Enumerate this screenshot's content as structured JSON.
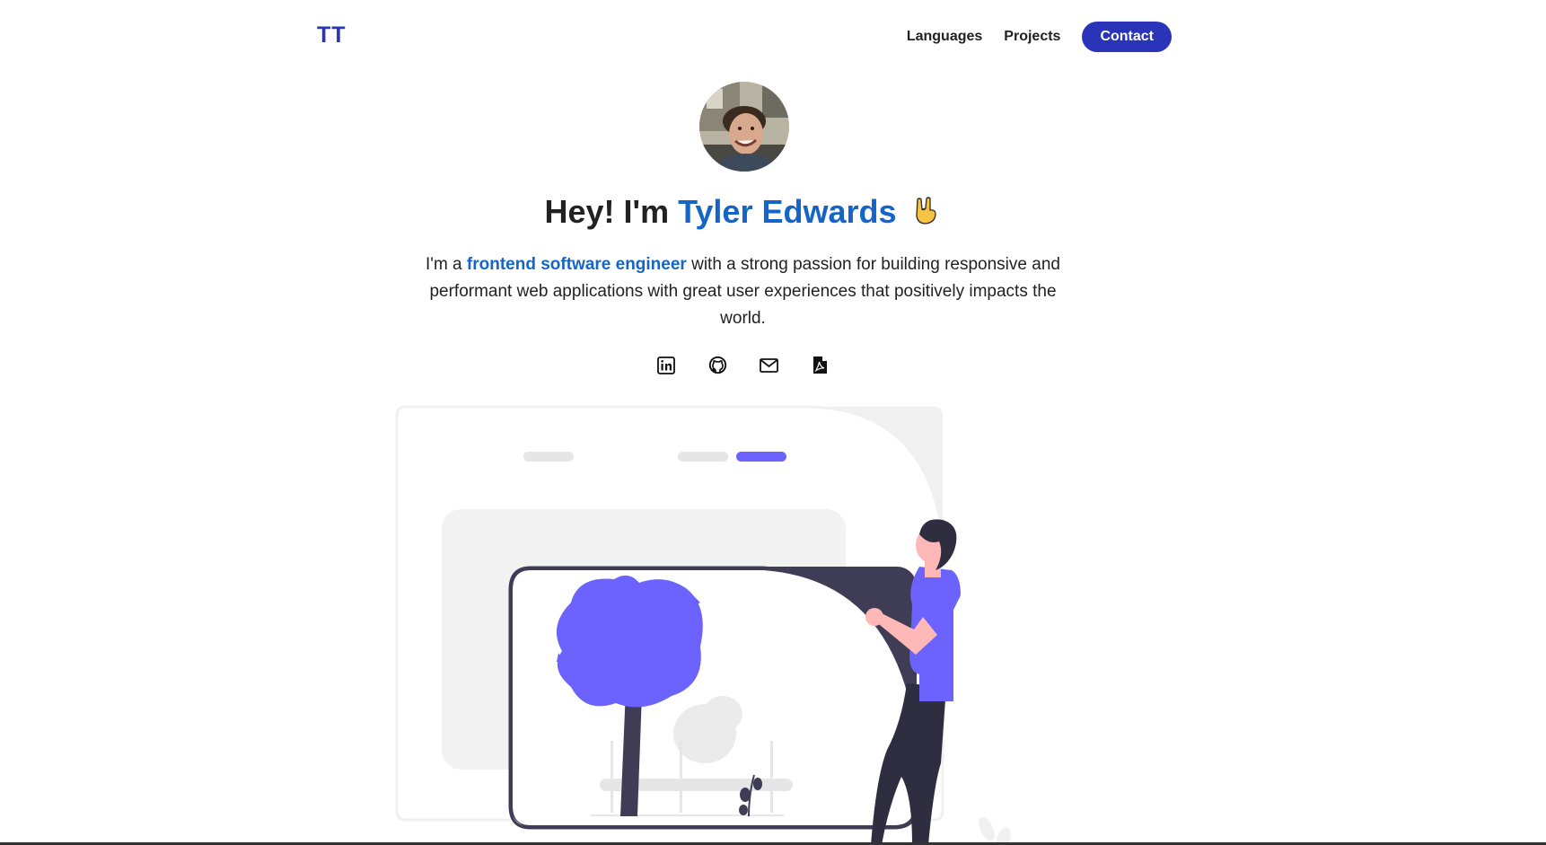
{
  "header": {
    "logo": "TT",
    "nav": {
      "languages": "Languages",
      "projects": "Projects",
      "contact": "Contact"
    }
  },
  "hero": {
    "greeting": "Hey! I'm ",
    "name": "Tyler Edwards",
    "intro_prefix": "I'm a ",
    "intro_highlight": "frontend software engineer",
    "intro_suffix": " with a strong passion for building responsive and performant web applications with great user experiences that positively impacts the world."
  },
  "socials": [
    {
      "icon": "linkedin-icon"
    },
    {
      "icon": "github-icon"
    },
    {
      "icon": "envelope-icon"
    },
    {
      "icon": "pdf-icon"
    }
  ],
  "colors": {
    "brand": "#2a34b8",
    "accent_text": "#1565c8",
    "illustration_purple": "#6c63ff",
    "illustration_dark": "#3f3d56"
  }
}
